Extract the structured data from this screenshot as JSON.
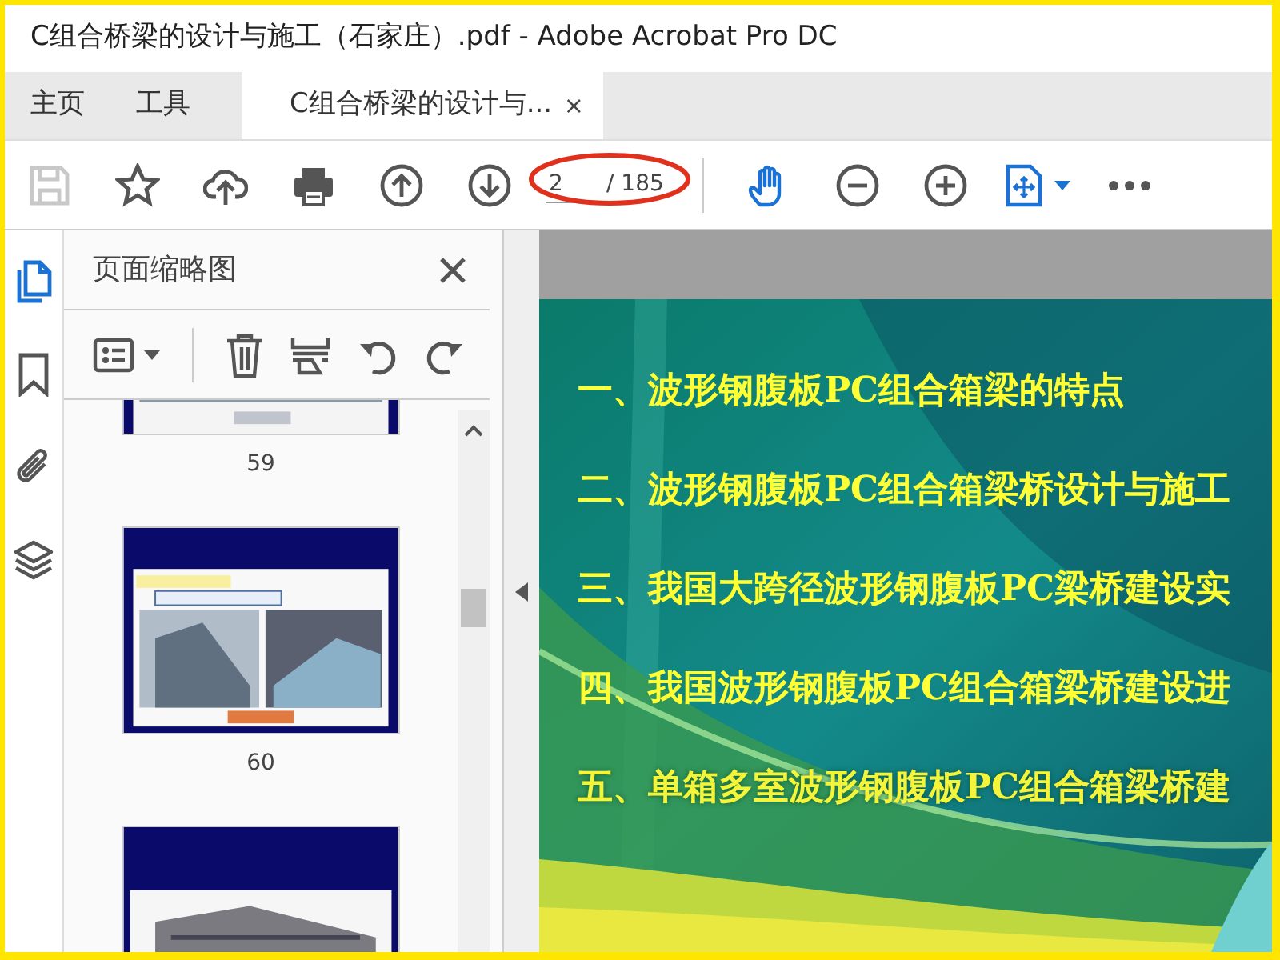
{
  "window": {
    "title": "C组合桥梁的设计与施工（石家庄）.pdf - Adobe Acrobat Pro DC"
  },
  "tabs": [
    {
      "label": "主页",
      "selected": false
    },
    {
      "label": "工具",
      "selected": false
    },
    {
      "label": "C组合桥梁的设计与...",
      "selected": true,
      "close": "×"
    }
  ],
  "toolbar": {
    "page_field": {
      "value": "2"
    },
    "page_count": "/ 185"
  },
  "rail": [
    {
      "kind": "pages",
      "selected": true
    },
    {
      "kind": "bookmarks",
      "selected": false
    },
    {
      "kind": "attachments",
      "selected": false
    },
    {
      "kind": "layers",
      "selected": false
    }
  ],
  "sidebar": {
    "title": "页面缩略图",
    "thumbnails": [
      {
        "kind": "picture",
        "label": "59"
      },
      {
        "kind": "picture",
        "label": "60"
      },
      {
        "kind": "picture"
      }
    ]
  },
  "slide": {
    "lines": [
      "一、波形钢腹板PC组合箱梁的特点",
      "二、波形钢腹板PC组合箱梁桥设计与施工",
      "三、我国大跨径波形钢腹板PC梁桥建设实",
      "四、我国波形钢腹板PC组合箱梁桥建设进",
      "五、单箱多室波形钢腹板PC组合箱梁桥建"
    ]
  }
}
